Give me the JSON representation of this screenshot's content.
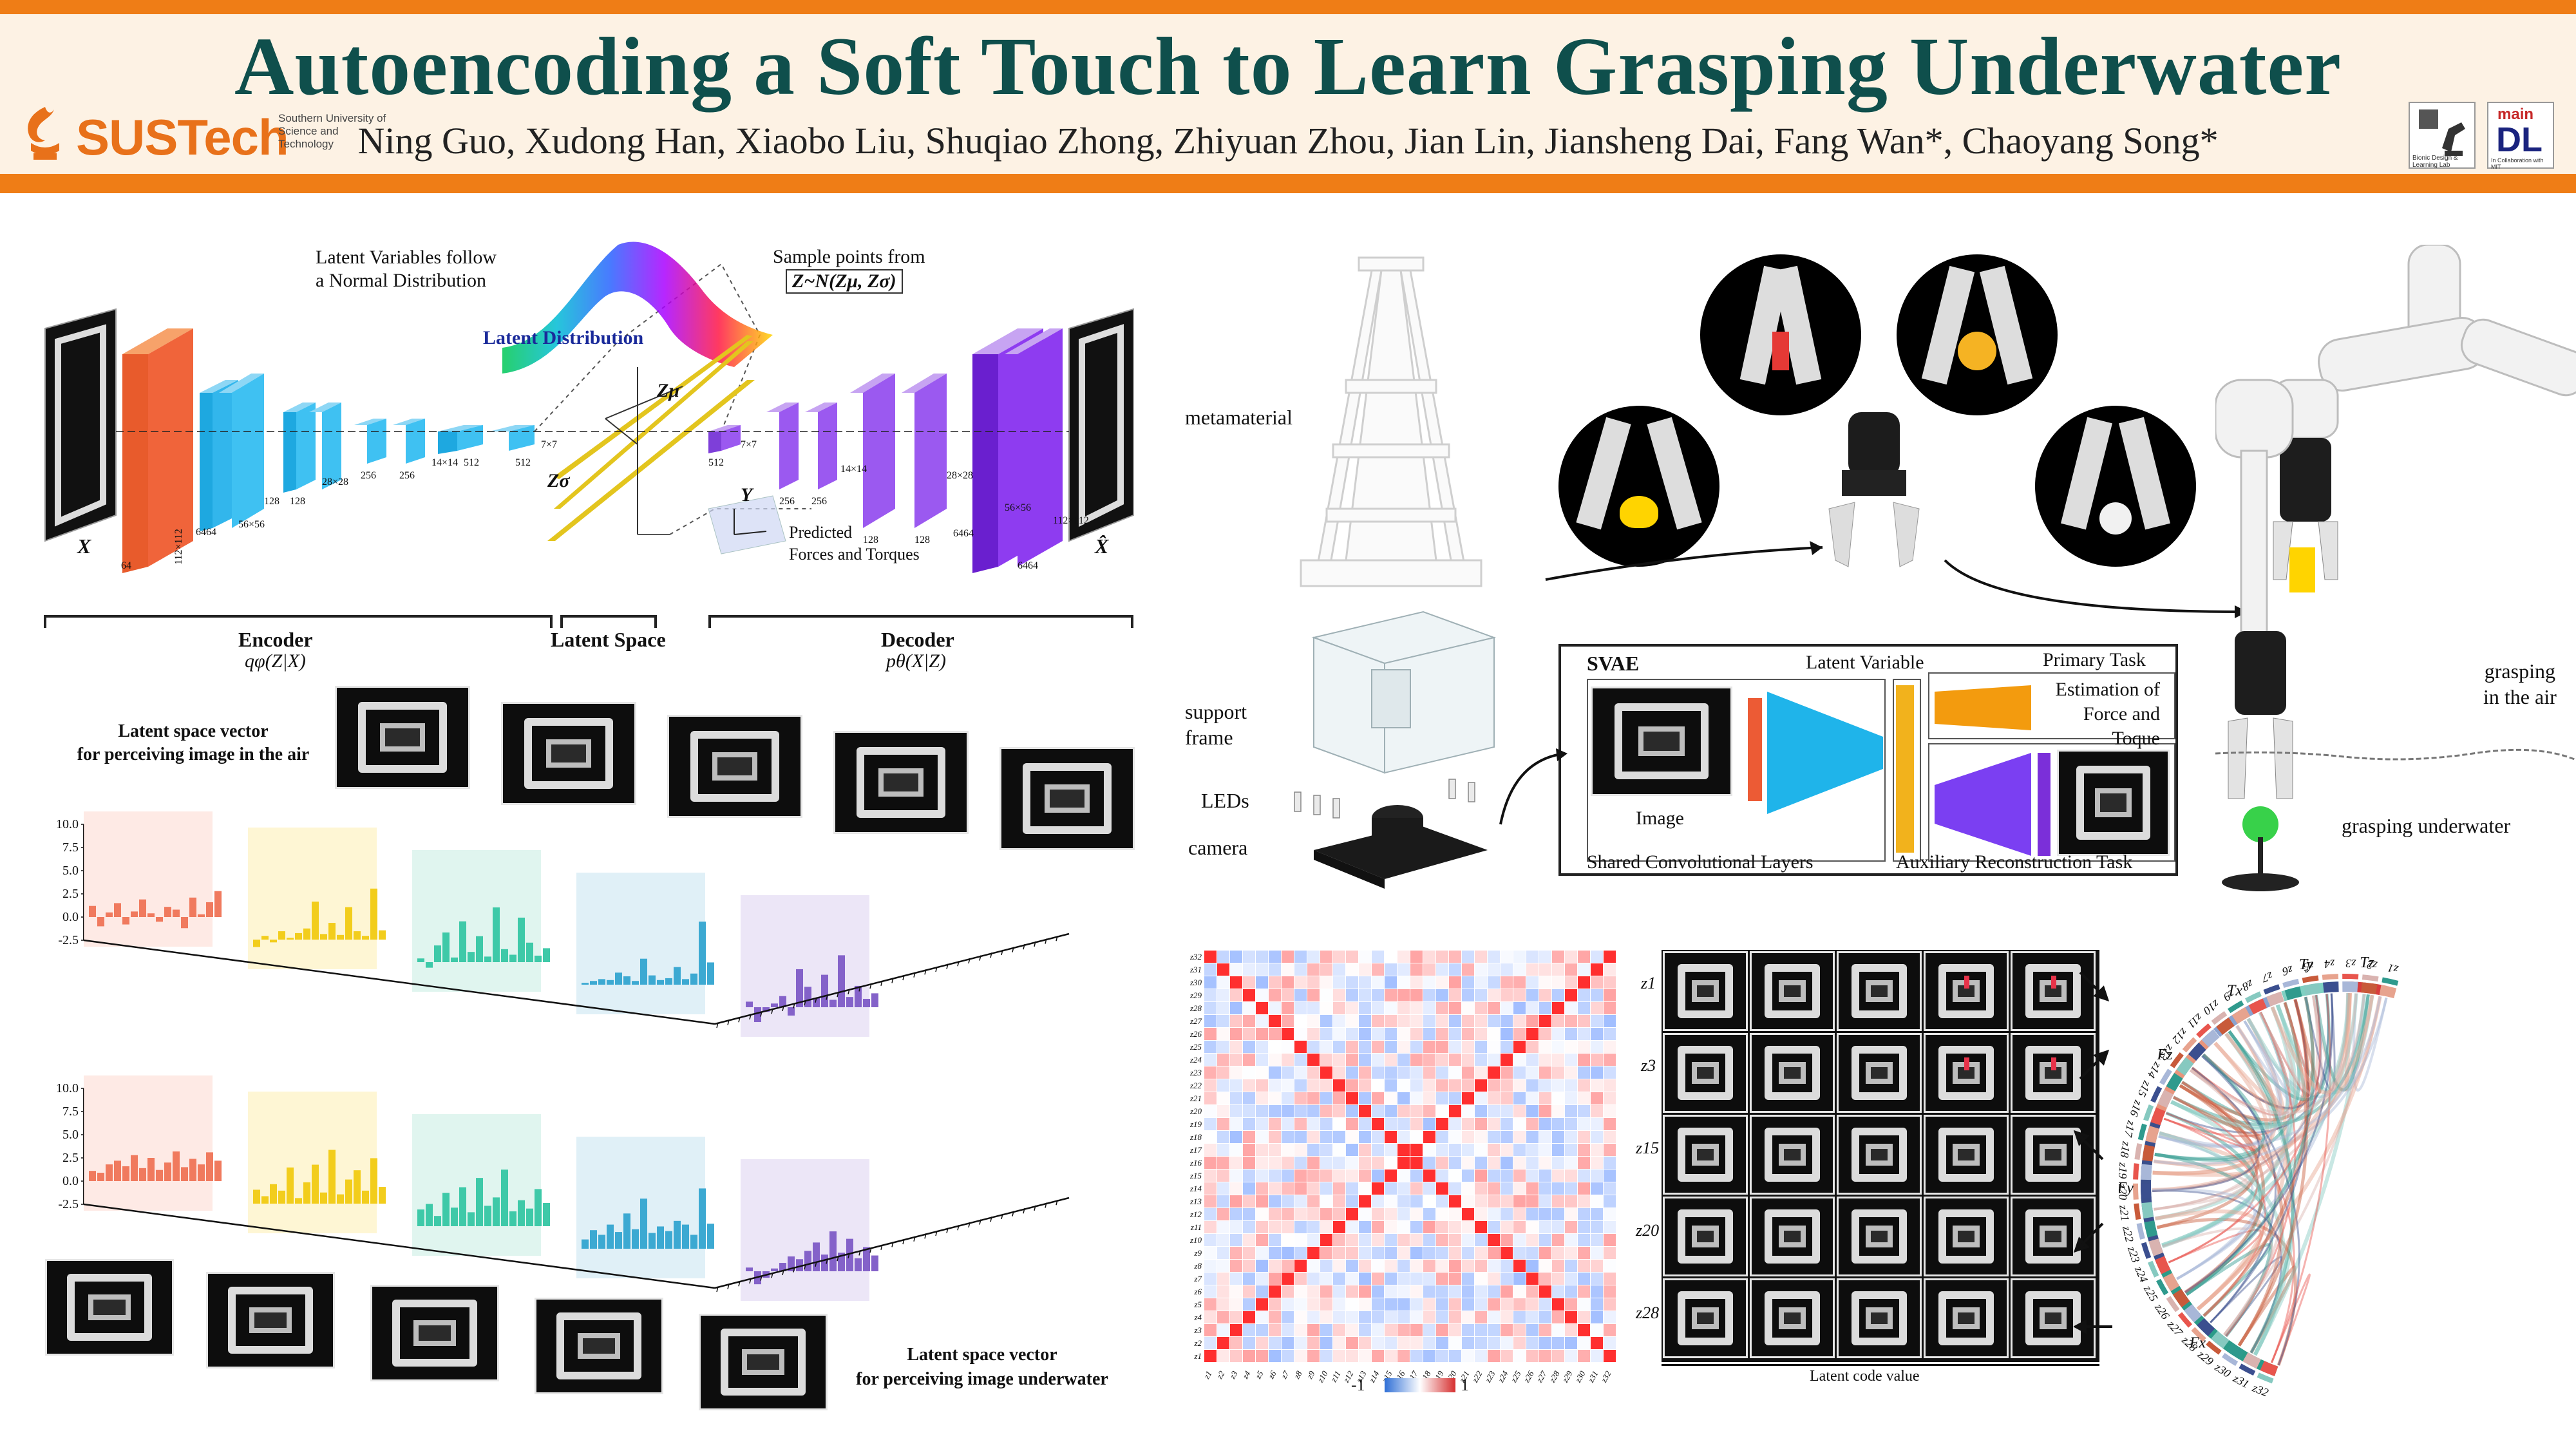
{
  "poster": {
    "title": "Autoencoding a Soft Touch to Learn Grasping Underwater",
    "authors": "Ning Guo, Xudong Han, Xiaobo Liu, Shuqiao Zhong, Zhiyuan Zhou, Jian Lin, Jiansheng Dai, Fang Wan*, Chaoyang Song*",
    "logo_name": "SUSTech",
    "logo_sub": "Southern University of Science and Technology",
    "right_logo_1": "Bionic Design & Learning Lab",
    "right_logo_2": "DL",
    "right_logo_2_top": "main",
    "right_logo_2_sub": "In Collaboration with MIT",
    "colors": {
      "accent": "#ef7d16",
      "title": "#0f4f4c",
      "header_bg": "#fdf2e4"
    }
  },
  "network": {
    "latent_follow": [
      "Latent Variables follow",
      "a Normal Distribution"
    ],
    "sample_points": "Sample points from",
    "sample_formula": "Z~N(Zμ, Zσ)",
    "latent_distribution": "Latent Distribution",
    "x_label": "X",
    "xhat_label": "X̂",
    "z_mu": "Zμ",
    "z_sigma": "Zσ",
    "y_label": "Y",
    "predicted": [
      "Predicted",
      "Forces and Torques"
    ],
    "dims_enc": [
      "64",
      "112×112",
      "6464",
      "56×56",
      "128",
      "128",
      "28×28",
      "256",
      "256",
      "14×14",
      "512",
      "512",
      "7×7"
    ],
    "dims_dec": [
      "512",
      "7×7",
      "256",
      "256",
      "14×14",
      "128",
      "128",
      "28×28",
      "6464",
      "56×56",
      "6464",
      "112×112"
    ],
    "encoder": "Encoder",
    "encoder_sub": "qφ(Z|X)",
    "latent_space": "Latent Space",
    "decoder": "Decoder",
    "decoder_sub": "pθ(X|Z)"
  },
  "latent_air": [
    "Latent space vector",
    "for perceiving image in the air"
  ],
  "latent_water": [
    "Latent space vector",
    "for perceiving image underwater"
  ],
  "chart_data": [
    {
      "type": "bar",
      "title": "",
      "ylim": [
        -2.5,
        10.0
      ],
      "yticks": [
        "10.0",
        "7.5",
        "5.0",
        "2.5",
        "0.0",
        "-2.5"
      ],
      "x": "z1–z32",
      "series": [
        {
          "values": [
            1.2,
            -1.0,
            0.5,
            1.5,
            -0.8,
            0.6,
            1.9,
            0.4,
            -0.5,
            1.1,
            0.8,
            -1.2,
            2.1,
            0.3,
            1.6,
            2.8
          ]
        },
        {
          "values": [
            -0.8,
            0.4,
            -0.3,
            0.9,
            0.2,
            0.7,
            1.2,
            4.1,
            0.6,
            1.8,
            0.5,
            3.5,
            0.9,
            0.4,
            5.5,
            1.0
          ]
        },
        {
          "values": [
            0.4,
            -0.6,
            1.8,
            3.2,
            0.5,
            4.4,
            1.1,
            2.8,
            0.6,
            5.9,
            1.4,
            0.8,
            4.8,
            2.1,
            0.7,
            1.5
          ]
        },
        {
          "values": [
            0.2,
            0.4,
            0.6,
            0.5,
            1.3,
            0.9,
            0.4,
            2.8,
            1.0,
            0.5,
            0.7,
            1.9,
            0.6,
            1.2,
            6.8,
            2.4
          ]
        },
        {
          "values": [
            0.6,
            -1.6,
            -0.5,
            0.4,
            1.2,
            -0.9,
            4.1,
            2.2,
            1.0,
            3.5,
            0.8,
            5.6,
            1.1,
            2.3,
            0.9,
            1.5
          ]
        }
      ]
    },
    {
      "type": "bar",
      "title": "",
      "ylim": [
        -2.5,
        10.0
      ],
      "yticks": [
        "10.0",
        "7.5",
        "5.0",
        "2.5",
        "0.0",
        "-2.5"
      ],
      "x": "z1–z32",
      "series": [
        {
          "values": [
            1.1,
            0.9,
            1.8,
            2.2,
            1.6,
            2.8,
            1.4,
            2.5,
            1.2,
            2.0,
            3.2,
            1.5,
            2.4,
            1.8,
            3.1,
            2.2
          ]
        },
        {
          "values": [
            1.5,
            0.8,
            2.1,
            1.4,
            3.9,
            0.6,
            2.3,
            4.2,
            1.2,
            5.8,
            1.0,
            2.6,
            3.6,
            1.4,
            4.9,
            1.8
          ]
        },
        {
          "values": [
            1.8,
            2.4,
            1.1,
            3.6,
            2.0,
            4.2,
            1.5,
            5.2,
            2.2,
            3.1,
            6.1,
            1.6,
            2.8,
            1.9,
            4.0,
            2.5
          ]
        },
        {
          "values": [
            1.0,
            2.0,
            1.5,
            2.6,
            1.8,
            3.8,
            2.1,
            5.4,
            1.7,
            2.4,
            1.9,
            3.0,
            2.6,
            1.5,
            6.5,
            2.7
          ]
        },
        {
          "values": [
            0.4,
            -1.4,
            -0.7,
            0.3,
            0.9,
            1.6,
            1.3,
            2.2,
            3.1,
            1.8,
            4.3,
            2.0,
            3.5,
            1.4,
            2.6,
            1.7
          ]
        }
      ]
    }
  ],
  "hardware": {
    "metamaterial": "metamaterial",
    "support_frame": [
      "support",
      "frame"
    ],
    "leds": "LEDs",
    "camera": "camera"
  },
  "svae": {
    "title": "SVAE",
    "latent_variable": "Latent Variable",
    "primary_task": "Primary Task",
    "estimation": [
      "Estimation of",
      "Force and Toque"
    ],
    "image": "Image",
    "shared": "Shared Convolutional Layers",
    "auxiliary": "Auxiliary Reconstruction Task"
  },
  "robot": {
    "grasping_air": [
      "grasping",
      "in the air"
    ],
    "grasping_underwater": "grasping underwater"
  },
  "heatmap": {
    "rows": [
      "z32",
      "z31",
      "z30",
      "z29",
      "z28",
      "z27",
      "z26",
      "z25",
      "z24",
      "z23",
      "z22",
      "z21",
      "z20",
      "z19",
      "z18",
      "z17",
      "z16",
      "z15",
      "z14",
      "z13",
      "z12",
      "z11",
      "z10",
      "z9",
      "z8",
      "z7",
      "z6",
      "z5",
      "z4",
      "z3",
      "z2",
      "z1"
    ],
    "scale_min": "-1",
    "scale_max": "1"
  },
  "traversal": {
    "rows": [
      "z1",
      "z3",
      "z15",
      "z20",
      "z28"
    ],
    "xlabel": "Latent code value"
  },
  "chord": {
    "top_labels": [
      "Fx",
      "Fy",
      "Fz",
      "Tx",
      "Ty",
      "Tz"
    ],
    "bottom_labels": [
      "z1",
      "z2",
      "z3",
      "z4",
      "z5",
      "z6",
      "z7",
      "z8",
      "z9",
      "z10",
      "z11",
      "z12",
      "z13",
      "z14",
      "z15",
      "z16",
      "z17",
      "z18",
      "z19",
      "z20",
      "z21",
      "z22",
      "z23",
      "z24",
      "z25",
      "z26",
      "z27",
      "z28",
      "z29",
      "z30",
      "z31",
      "z32"
    ]
  }
}
